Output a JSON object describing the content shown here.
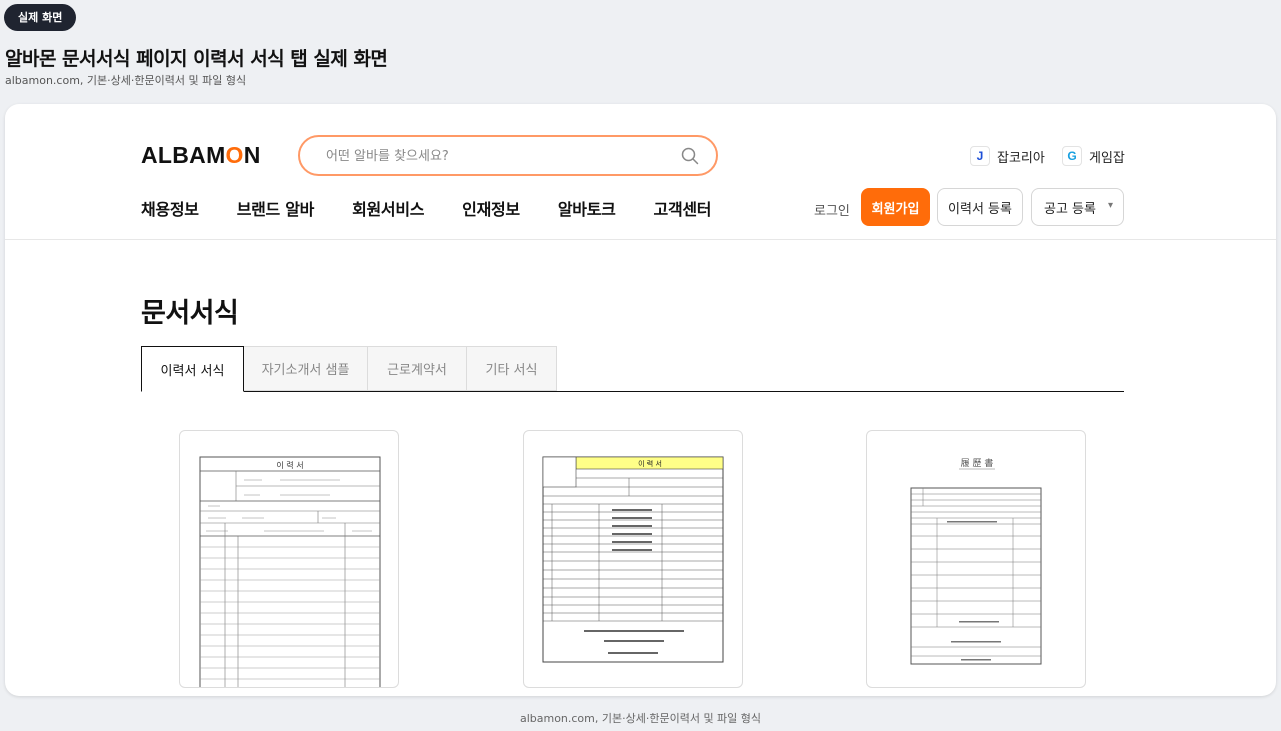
{
  "badge": "실제 화면",
  "page_heading": "알바몬 문서서식 페이지 이력서 서식 탭 실제 화면",
  "page_subtitle": "albamon.com, 기본·상세·한문이력서 및 파일 형식",
  "header": {
    "logo_before": "ALBAM",
    "logo_o": "O",
    "logo_after": "N",
    "search_placeholder": "어떤 알바를 찾으세요?",
    "partners": [
      {
        "icon_letter": "J",
        "label": "잡코리아"
      },
      {
        "icon_letter": "G",
        "label": "게임잡"
      }
    ],
    "nav": [
      "채용정보",
      "브랜드 알바",
      "회원서비스",
      "인재정보",
      "알바토크",
      "고객센터"
    ],
    "login": "로그인",
    "join": "회원가입",
    "resume_register": "이력서 등록",
    "post_register": "공고 등록"
  },
  "main": {
    "title": "문서서식",
    "tabs": [
      "이력서 서식",
      "자기소개서 샘플",
      "근로계약서",
      "기타 서식"
    ],
    "active_tab": "이력서 서식",
    "forms": [
      {
        "title": "이 력 서"
      },
      {
        "title": "이 력 서"
      },
      {
        "title": "履 歷 書"
      }
    ]
  },
  "footer_caption": "albamon.com, 기본·상세·한문이력서 및 파일 형식",
  "colors": {
    "accent": "#ff6c0a",
    "search_border": "#ff9966",
    "form_highlight": "#ffff88"
  }
}
